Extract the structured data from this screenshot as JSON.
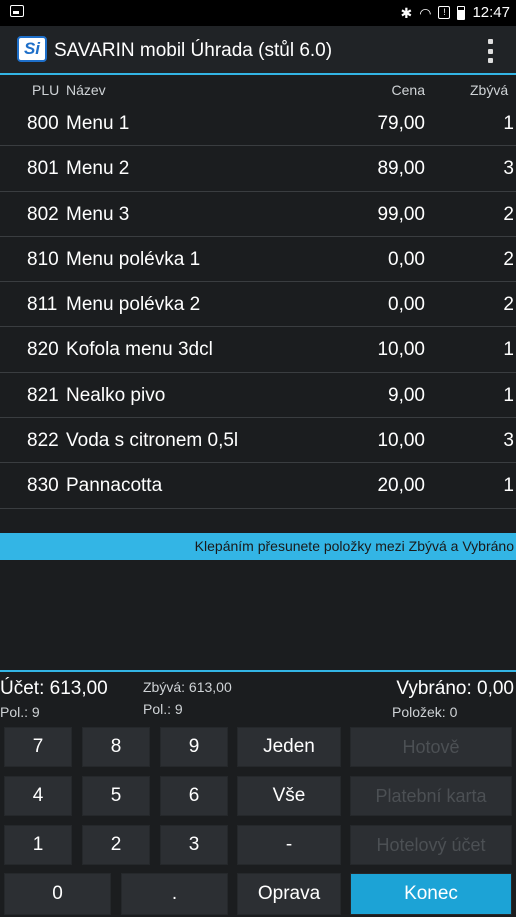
{
  "status_bar": {
    "time": "12:47",
    "icons": [
      "image-icon",
      "bluetooth-icon",
      "wifi-icon",
      "notification-icon",
      "battery-icon"
    ]
  },
  "app_bar": {
    "logo_text": "Si",
    "title": "SAVARIN mobil Úhrada (stůl 6.0)",
    "menu_icon": "overflow-menu-icon"
  },
  "table": {
    "headers": {
      "plu": "PLU",
      "name": "Název",
      "price": "Cena",
      "remaining": "Zbývá"
    },
    "rows": [
      {
        "plu": "800",
        "name": "Menu 1",
        "price": "79,00",
        "remaining": "1"
      },
      {
        "plu": "801",
        "name": "Menu 2",
        "price": "89,00",
        "remaining": "3"
      },
      {
        "plu": "802",
        "name": "Menu 3",
        "price": "99,00",
        "remaining": "2"
      },
      {
        "plu": "810",
        "name": "Menu polévka 1",
        "price": "0,00",
        "remaining": "2"
      },
      {
        "plu": "811",
        "name": "Menu polévka 2",
        "price": "0,00",
        "remaining": "2"
      },
      {
        "plu": "820",
        "name": "Kofola menu 3dcl",
        "price": "10,00",
        "remaining": "1"
      },
      {
        "plu": "821",
        "name": "Nealko pivo",
        "price": "9,00",
        "remaining": "1"
      },
      {
        "plu": "822",
        "name": "Voda s citronem 0,5l",
        "price": "10,00",
        "remaining": "3"
      },
      {
        "plu": "830",
        "name": "Pannacotta",
        "price": "20,00",
        "remaining": "1"
      }
    ]
  },
  "hint": "Klepáním přesunete položky mezi Zbývá a Vybráno",
  "summary": {
    "account": "Účet: 613,00",
    "account_items": "Pol.:  9",
    "remaining": "Zbývá: 613,00",
    "remaining_items": "Pol.:  9",
    "selected": "Vybráno: 0,00",
    "selected_items": "Položek:  0"
  },
  "keypad": {
    "k7": "7",
    "k8": "8",
    "k9": "9",
    "jeden": "Jeden",
    "hotove": "Hotově",
    "k4": "4",
    "k5": "5",
    "k6": "6",
    "vse": "Vše",
    "karta": "Platební karta",
    "k1": "1",
    "k2": "2",
    "k3": "3",
    "minus": "-",
    "hotel": "Hotelový účet",
    "k0": "0",
    "dot": ".",
    "oprava": "Oprava",
    "konec": "Konec"
  },
  "colors": {
    "accent": "#33b5e5",
    "primary_button": "#1ca3d6",
    "background": "#1b1d1f"
  }
}
